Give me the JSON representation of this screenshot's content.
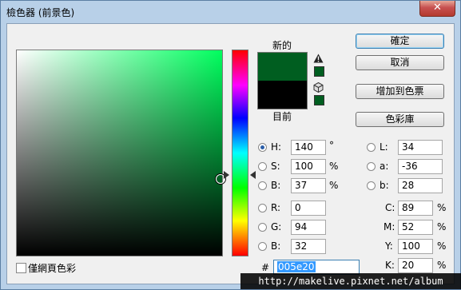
{
  "window": {
    "title": "檢色器 (前景色)",
    "close_label": "✕"
  },
  "swatches": {
    "new_label": "新的",
    "current_label": "目前",
    "new_color": "#005e20",
    "current_color": "#000000"
  },
  "buttons": {
    "ok": "確定",
    "cancel": "取消",
    "add_to_swatches": "增加到色票",
    "color_libraries": "色彩庫"
  },
  "hsb": {
    "h": {
      "label": "H:",
      "value": "140",
      "unit": "°",
      "selected": true
    },
    "s": {
      "label": "S:",
      "value": "100",
      "unit": "%"
    },
    "b": {
      "label": "B:",
      "value": "37",
      "unit": "%"
    }
  },
  "rgb": {
    "r": {
      "label": "R:",
      "value": "0"
    },
    "g": {
      "label": "G:",
      "value": "94"
    },
    "b": {
      "label": "B:",
      "value": "32"
    }
  },
  "lab": {
    "l": {
      "label": "L:",
      "value": "34"
    },
    "a": {
      "label": "a:",
      "value": "-36"
    },
    "b": {
      "label": "b:",
      "value": "28"
    }
  },
  "cmyk": {
    "c": {
      "label": "C:",
      "value": "89",
      "unit": "%"
    },
    "m": {
      "label": "M:",
      "value": "52",
      "unit": "%"
    },
    "y": {
      "label": "Y:",
      "value": "100",
      "unit": "%"
    },
    "k": {
      "label": "K:",
      "value": "20",
      "unit": "%"
    }
  },
  "hex": {
    "label": "#",
    "value": "005e20"
  },
  "web_colors_only": {
    "label": "僅網頁色彩",
    "checked": false
  },
  "watermark": "http://makelive.pixnet.net/album",
  "icons": {
    "gamut_warning": "warning-triangle-icon",
    "web_safe": "cube-icon"
  }
}
